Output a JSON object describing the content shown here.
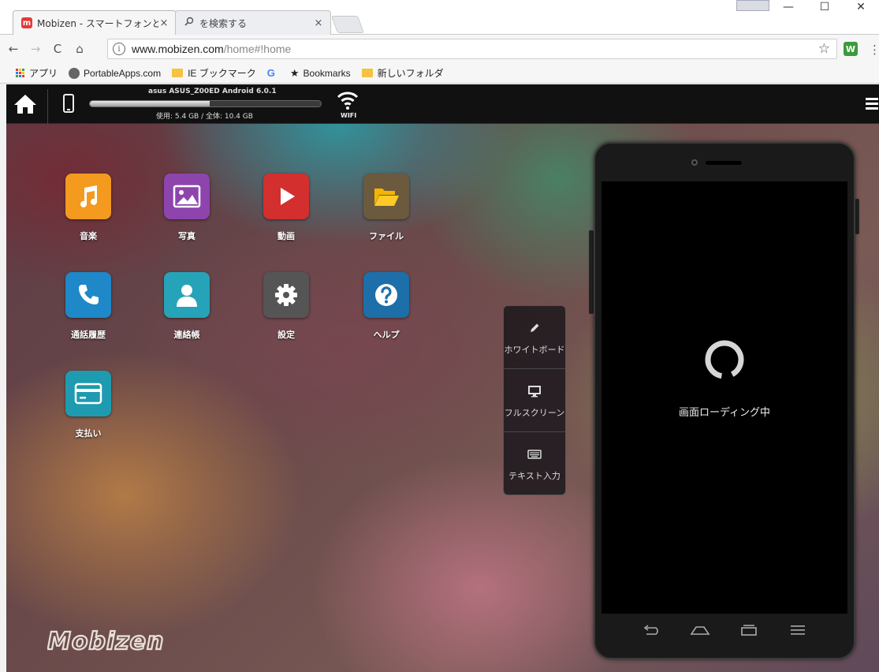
{
  "browser": {
    "tabs": [
      {
        "title": "Mobizen - スマートフォンと/",
        "close": "×"
      },
      {
        "title": "を検索する",
        "close": "×"
      }
    ],
    "window_controls": {
      "minimize": "—",
      "maximize": "☐",
      "close": "✕"
    },
    "nav": {
      "back": "←",
      "forward": "→",
      "reload": "C",
      "home": "⌂"
    },
    "url": {
      "host": "www.mobizen.com",
      "path": "/home#!home",
      "info": "i"
    },
    "star": "☆",
    "extension_label": "W",
    "menu": "⋮",
    "bookmarks": [
      {
        "label": "アプリ",
        "icon": "apps-grid-icon"
      },
      {
        "label": "PortableApps.com",
        "icon": "portableapps-icon"
      },
      {
        "label": "IE ブックマーク",
        "icon": "folder-icon"
      },
      {
        "label": "",
        "icon": "google-icon",
        "glyph": "G"
      },
      {
        "label": "Bookmarks",
        "icon": "star-icon",
        "glyph": "★"
      },
      {
        "label": "新しいフォルダ",
        "icon": "folder-icon"
      }
    ]
  },
  "topbar": {
    "device_name": "asus ASUS_Z00ED Android 6.0.1",
    "storage_text": "使用: 5.4 GB / 全体: 10.4 GB",
    "storage_used_fraction": 0.52,
    "wifi_label": "WIFI"
  },
  "apps": [
    {
      "label": "音楽",
      "color": "#f39a1f",
      "icon": "music-note-icon"
    },
    {
      "label": "写真",
      "color": "#8e44ad",
      "icon": "photo-icon"
    },
    {
      "label": "動画",
      "color": "#d32f2f",
      "icon": "play-icon"
    },
    {
      "label": "ファイル",
      "color": "#6b5a3e",
      "icon": "folder-open-icon"
    },
    {
      "label": "通話履歴",
      "color": "#1e88c8",
      "icon": "phone-icon"
    },
    {
      "label": "連絡帳",
      "color": "#26a3b8",
      "icon": "contact-icon"
    },
    {
      "label": "設定",
      "color": "#555555",
      "icon": "gear-icon"
    },
    {
      "label": "ヘルプ",
      "color": "#1c6fa8",
      "icon": "help-icon"
    },
    {
      "label": "支払い",
      "color": "#1e9bb0",
      "icon": "card-icon"
    }
  ],
  "side_panel": [
    {
      "label": "ホワイトボード",
      "icon": "pencil-icon"
    },
    {
      "label": "フルスクリーン",
      "icon": "monitor-icon"
    },
    {
      "label": "テキスト入力",
      "icon": "keyboard-icon"
    }
  ],
  "phone": {
    "loading_text": "画面ローディング中"
  },
  "logo": "Mobizen"
}
